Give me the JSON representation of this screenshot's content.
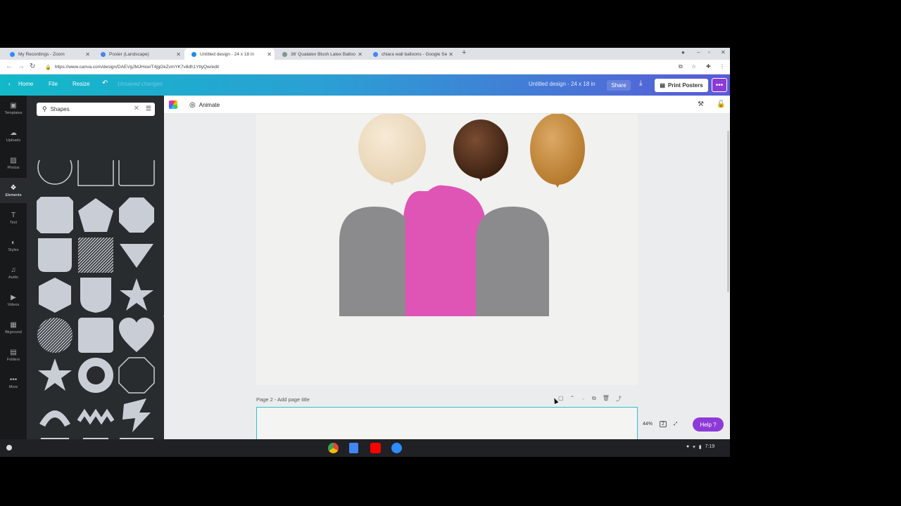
{
  "browser": {
    "tabs": [
      {
        "title": "My Recordings - Zoom",
        "color": "#2d8cff"
      },
      {
        "title": "Poster (Landscape)",
        "color": "#4285f4"
      },
      {
        "title": "Untitled design - 24 x 18 in",
        "color": "#1f8ce6"
      },
      {
        "title": "36' Qualatex Blush Latex Balloo",
        "color": "#7a9a8a"
      },
      {
        "title": "chiara wall balloons - Google Se",
        "color": "#4285f4"
      }
    ],
    "new_tab": "+",
    "url": "https://www.canva.com/design/DAEVgJMJHxw/T4jgGkZvmYK7v8dh1YtlyQw/edit"
  },
  "header": {
    "home": "Home",
    "file": "File",
    "resize": "Resize",
    "saved": "Unsaved changes",
    "design_title": "Untitled design - 24 x 18 in",
    "share": "Share",
    "print": "Print Posters",
    "more": "•••"
  },
  "rail": [
    {
      "label": "Templates",
      "icon": "▣"
    },
    {
      "label": "Uploads",
      "icon": "☁"
    },
    {
      "label": "Photos",
      "icon": "▨"
    },
    {
      "label": "Elements",
      "icon": "❖"
    },
    {
      "label": "Text",
      "icon": "T"
    },
    {
      "label": "Styles",
      "icon": "◐"
    },
    {
      "label": "Audio",
      "icon": "♫"
    },
    {
      "label": "Videos",
      "icon": "▶"
    },
    {
      "label": "Bkground",
      "icon": "▦"
    },
    {
      "label": "Folders",
      "icon": "▤"
    },
    {
      "label": "More",
      "icon": "•••"
    }
  ],
  "panel": {
    "search_value": "Shapes"
  },
  "toolbar": {
    "animate": "Animate"
  },
  "canvas": {
    "balloon_colors": [
      "#efdcc0",
      "#5a3420",
      "#c98c3a"
    ],
    "arch_colors": [
      "#8b8a8d",
      "#df55b6",
      "#8b8a8d"
    ]
  },
  "pages": {
    "page2_label": "Page 2 - Add page title"
  },
  "status": {
    "zoom": "44%",
    "page_count": "2",
    "help": "Help ?",
    "time": "7:19"
  }
}
